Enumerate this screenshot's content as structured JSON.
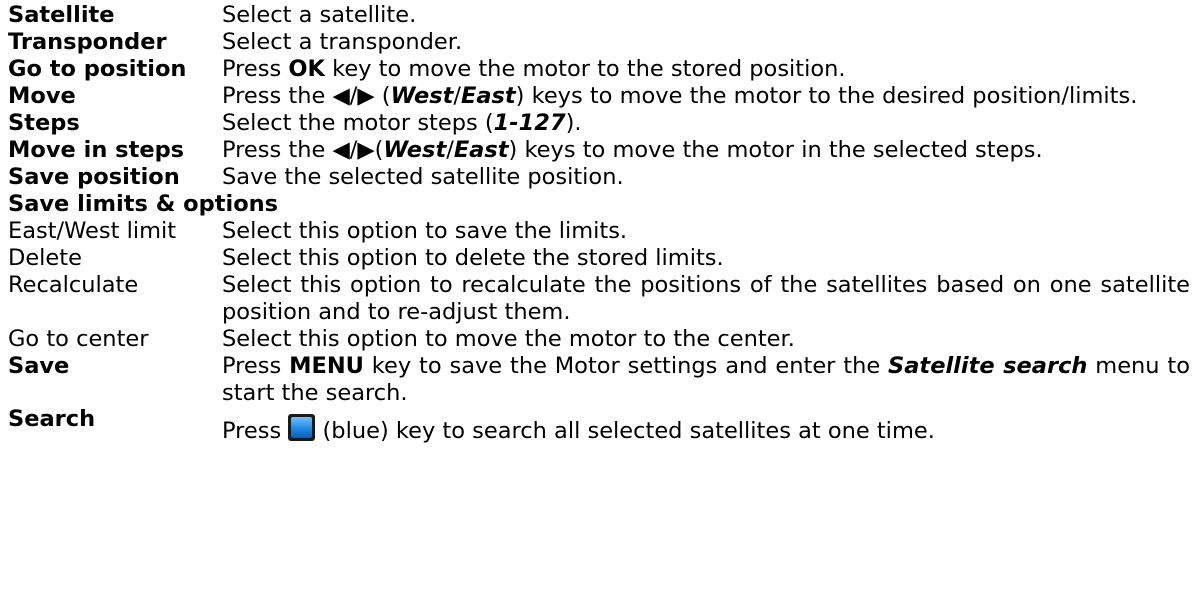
{
  "entries": [
    {
      "term": "Satellite",
      "desc": "Select a satellite."
    },
    {
      "term": "Transponder",
      "desc": "Select a transponder."
    },
    {
      "term": "Go to position",
      "desc_pre": "Press ",
      "desc_key": "OK",
      "desc_post": " key to move the motor to the stored position."
    },
    {
      "term": "Move",
      "desc_pre": "Press the ◀/▶ (",
      "west": "West",
      "slash": "/",
      "east": "East",
      "desc_post": ") keys to move the motor to the desired position/limits."
    },
    {
      "term": "Steps",
      "desc_pre": "Select the motor steps (",
      "range": "1-127",
      "desc_post": ")."
    },
    {
      "term": "Move in steps",
      "desc_pre": "Press the ◀/▶(",
      "west": "West",
      "slash": "/",
      "east": "East",
      "desc_post": ") keys to move the motor in the selected steps."
    },
    {
      "term": "Save position",
      "desc": "Save the selected satellite position."
    }
  ],
  "section_heading": "Save limits & options",
  "options": [
    {
      "term": "East/West limit",
      "desc": "Select this option to save the limits."
    },
    {
      "term": "Delete",
      "desc": "Select this option to delete the stored limits."
    },
    {
      "term": "Recalculate",
      "desc": "Select this option to recalculate the positions of the satellites based on one satellite position and to re-adjust them."
    },
    {
      "term": "Go to center",
      "desc": "Select this option to move the motor to the center."
    }
  ],
  "save": {
    "term": "Save",
    "desc_pre": "Press ",
    "desc_key": "MENU",
    "desc_mid": " key to save the Motor settings and enter the ",
    "desc_menu": "Satellite search",
    "desc_post": " menu to start the search."
  },
  "search": {
    "term": "Search",
    "desc_pre": "Press ",
    "key_icon": "blue-key-icon",
    "desc_post": " (blue) key to search all selected satellites at one time."
  }
}
